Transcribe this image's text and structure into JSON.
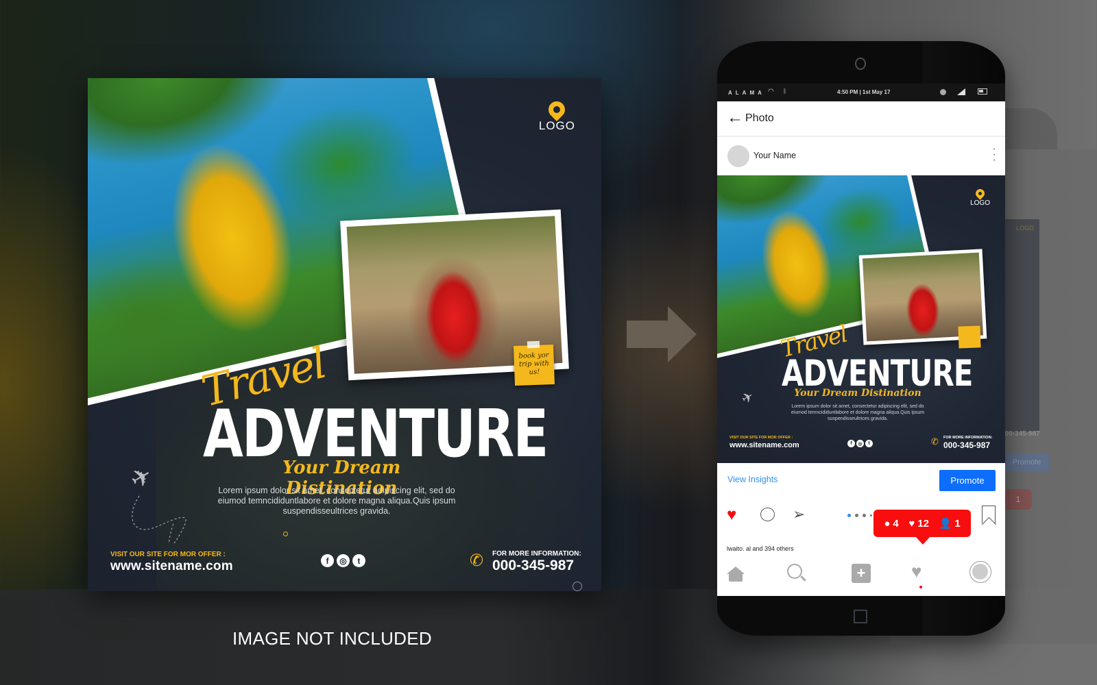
{
  "caption": "IMAGE NOT INCLUDED",
  "flyer": {
    "logo": "LOGO",
    "sticky_note": "book yor trip with us!",
    "headline_script": "Travel",
    "headline": "ADVENTURE",
    "tagline": "Your Dream Distination",
    "body": "Lorem ipsum dolor sit amet, consectetur adipiscing elit, sed do eiumod temncididuntlabore et dolore magna aliqua.Quis ipsum suspendisseultrices gravida.",
    "visit_label": "VISIT OUR SITE FOR MOR OFFER :",
    "site_url": "www.sitename.com",
    "social_icons": [
      "f",
      "◎",
      "t"
    ],
    "info_label": "FOR MORE INFORMATION:",
    "phone_number": "000-345-987",
    "accent_color": "#f4b81c"
  },
  "phone": {
    "status_bar": {
      "carrier": "ALAMA",
      "time": "4:50 PM | 1st May 17"
    },
    "header": {
      "back_icon": "←",
      "title": "Photo"
    },
    "post": {
      "user_name": "Your Name",
      "more_icon": "⋮"
    },
    "insights": {
      "view_insights": "View Insights",
      "promote": "Promote"
    },
    "actions": {
      "like_icon": "♥",
      "share_icon": "➢"
    },
    "notifications": {
      "comments": "4",
      "likes": "12",
      "followers": "1"
    },
    "liked_by": "lwaito. al  and 394 others",
    "nav": {
      "add": "+",
      "heart": "♥"
    },
    "ghost": {
      "logo": "LOGO",
      "phone": "000-345-987",
      "promote": "Promote",
      "badge": "1"
    }
  }
}
